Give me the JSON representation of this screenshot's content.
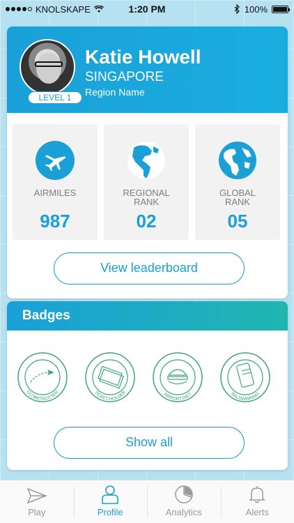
{
  "status_bar": {
    "carrier": "KNOLSKAPE",
    "time": "1:20 PM",
    "battery": "100%",
    "battery_level": 1.0
  },
  "profile": {
    "name": "Katie Howell",
    "country": "SINGAPORE",
    "region": "Region Name",
    "level": "LEVEL 1"
  },
  "stats": [
    {
      "label_line1": "AIRMILES",
      "label_line2": "",
      "value": "987",
      "icon": "airplane-icon"
    },
    {
      "label_line1": "REGIONAL",
      "label_line2": "RANK",
      "value": "02",
      "icon": "americas-globe-icon"
    },
    {
      "label_line1": "GLOBAL",
      "label_line2": "RANK",
      "value": "05",
      "icon": "globe-icon"
    }
  ],
  "leaderboard_button": "View leaderboard",
  "badges": {
    "title": "Badges",
    "items": [
      {
        "label": "GLOBETROTTER",
        "icon": "globetrotter-badge-icon"
      },
      {
        "label": "TICKET-HOLDER",
        "icon": "ticket-holder-badge-icon"
      },
      {
        "label": "AIRPORT DIET",
        "icon": "airport-diet-badge-icon"
      },
      {
        "label": "BALDWINNING",
        "icon": "baldwinning-badge-icon"
      }
    ],
    "show_all": "Show all"
  },
  "tabs": [
    {
      "label": "Play",
      "icon": "paper-plane-icon",
      "active": false
    },
    {
      "label": "Profile",
      "icon": "person-icon",
      "active": true
    },
    {
      "label": "Analytics",
      "icon": "pie-chart-icon",
      "active": false
    },
    {
      "label": "Alerts",
      "icon": "bell-icon",
      "active": false
    }
  ],
  "colors": {
    "accent": "#1a9fd6",
    "badge_green": "#3aa67a",
    "background": "#b5e1f1"
  }
}
